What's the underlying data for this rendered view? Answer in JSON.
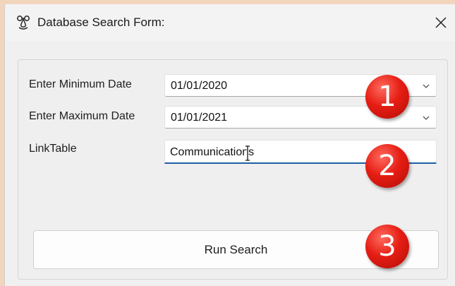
{
  "window": {
    "title": "Database Search Form:",
    "app_icon": "nose-glasses-icon",
    "close_label": "✕"
  },
  "form": {
    "min_date": {
      "label": "Enter Minimum Date",
      "value": "01/01/2020"
    },
    "max_date": {
      "label": "Enter Maximum Date",
      "value": "01/01/2021"
    },
    "link_table": {
      "label": "LinkTable",
      "value": "Communications"
    },
    "run_button": "Run Search"
  },
  "markers": [
    "1",
    "2",
    "3"
  ],
  "colors": {
    "marker_red": "#e61e14",
    "focus_underline": "#1c5fa8",
    "outer_background": "#f1d5bd"
  }
}
